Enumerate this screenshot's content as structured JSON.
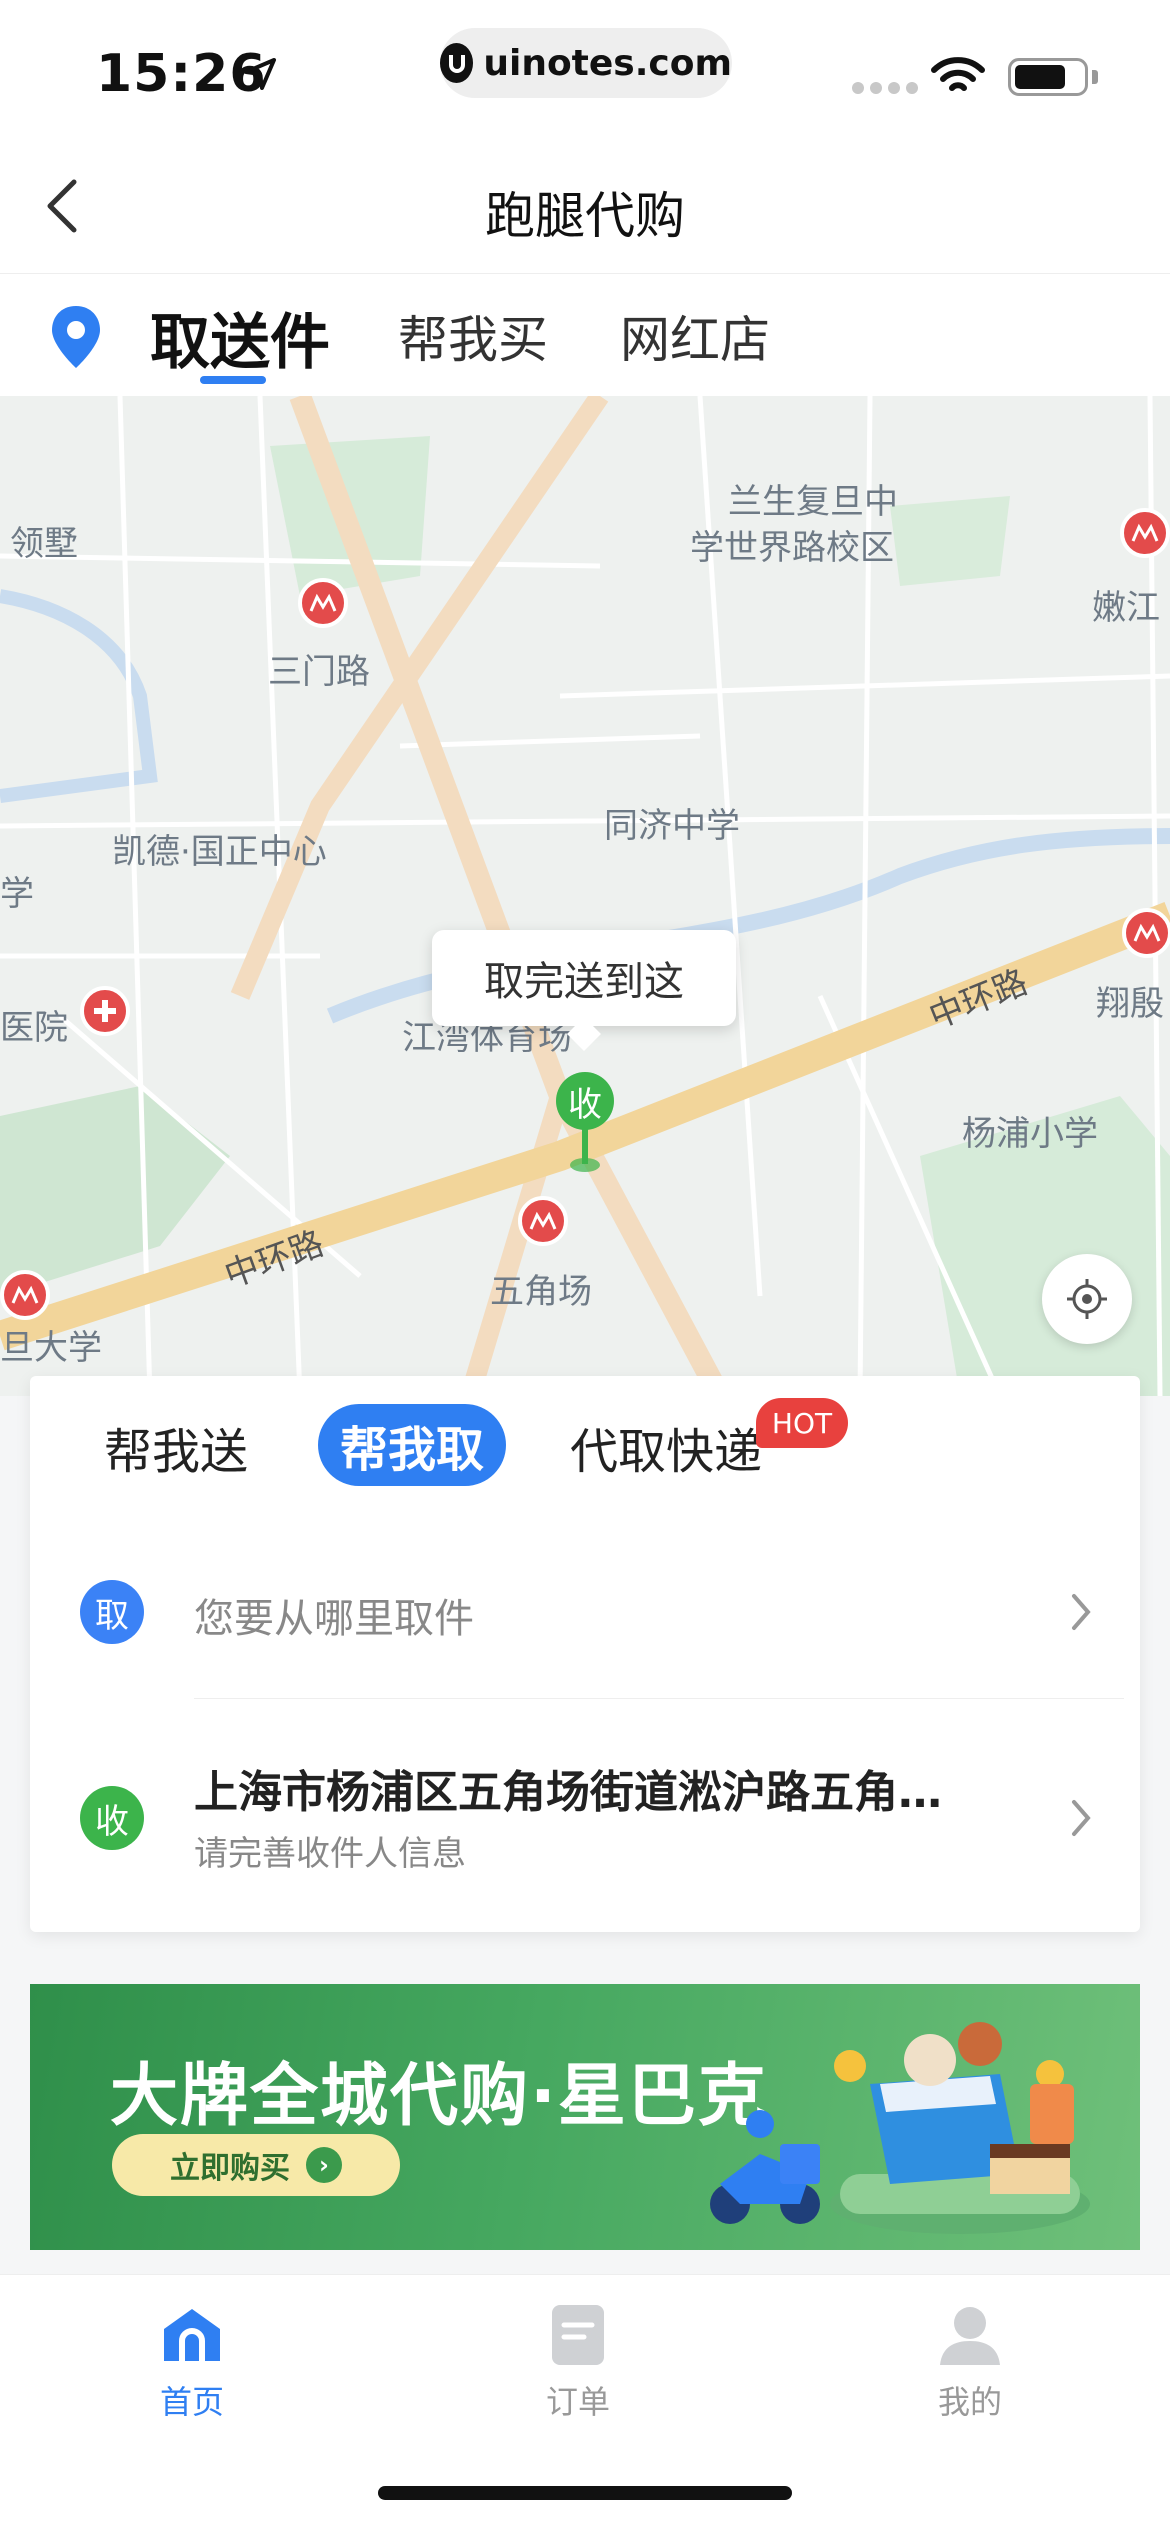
{
  "status_bar": {
    "time": "15:26",
    "url": "uinotes.com"
  },
  "nav": {
    "title": "跑腿代购"
  },
  "top_tabs": [
    "取送件",
    "帮我买",
    "网红店"
  ],
  "map": {
    "labels": [
      "兰生复旦中",
      "学世界路校区",
      "三门路",
      "嫩江",
      "同济中学",
      "凯德·国正中心",
      "翔殷",
      "医院",
      "江湾体育场",
      "杨浦小学",
      "五角场",
      "旦大学",
      "领墅",
      "学"
    ],
    "road_labels": [
      "中环路",
      "中环路"
    ],
    "callout": "取完送到这",
    "pin_label": "收"
  },
  "service_tabs": [
    "帮我送",
    "帮我取",
    "代取快递"
  ],
  "hot_badge": "HOT",
  "pickup": {
    "icon": "取",
    "placeholder": "您要从哪里取件"
  },
  "receive": {
    "icon": "收",
    "address": "上海市杨浦区五角场街道淞沪路五角…",
    "hint": "请完善收件人信息"
  },
  "banner": {
    "title": "大牌全城代购·星巴克",
    "button": "立即购买"
  },
  "bottom_tabs": [
    "首页",
    "订单",
    "我的"
  ],
  "colors": {
    "accent": "#2f7ff2",
    "green": "#3cb44b",
    "hot": "#e8413e"
  }
}
